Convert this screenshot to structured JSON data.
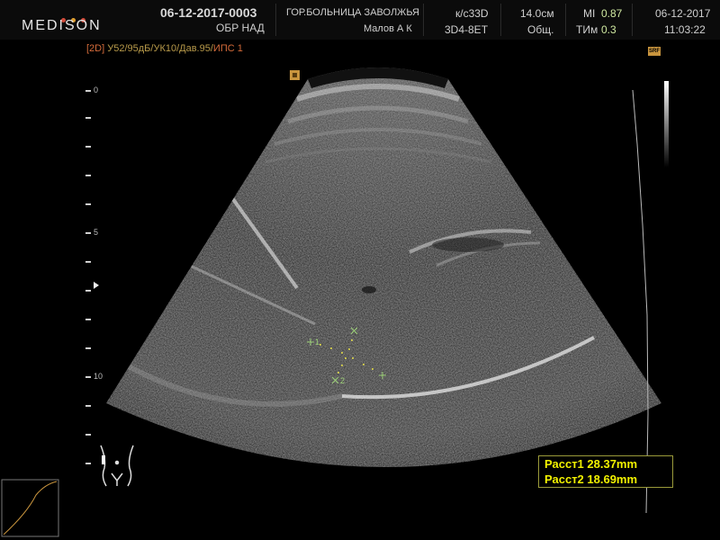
{
  "header": {
    "logo": "MEDISON",
    "patient_id": "06-12-2017-0003",
    "exam": "ОБР НАД",
    "hospital": "ГОР.БОЛЬНИЦА ЗАВОЛЖЬЯ",
    "operator": "Малов А К",
    "preset": "к/с33D",
    "probe": "3D4-8ET",
    "depth": "14.0см",
    "mode": "Общ.",
    "mi_label": "MI",
    "mi_value": "0.87",
    "tim_label": "ТИм",
    "tim_value": "0.3",
    "date": "06-12-2017",
    "time": "11:03:22"
  },
  "params": {
    "mode_tag": "[2D]",
    "settings": "У52/95дБ/УК10/Дав.95/",
    "ips": "ИПС 1"
  },
  "depth_scale": {
    "labels": [
      "0",
      "5",
      "10"
    ]
  },
  "markers": {
    "m1": "1",
    "m2": "2"
  },
  "measurements": {
    "dist1": "Расст1 28.37mm",
    "dist2": "Расст2 18.69mm"
  },
  "icons": [
    "focus-marker-icon",
    "orientation-marker-icon",
    "srf-icon",
    "body-mark-icon",
    "tgc-curve-icon"
  ],
  "colors": {
    "params_text": "#b89a4a",
    "measure_text": "#f2f200",
    "marker_green": "#9fd27a"
  }
}
